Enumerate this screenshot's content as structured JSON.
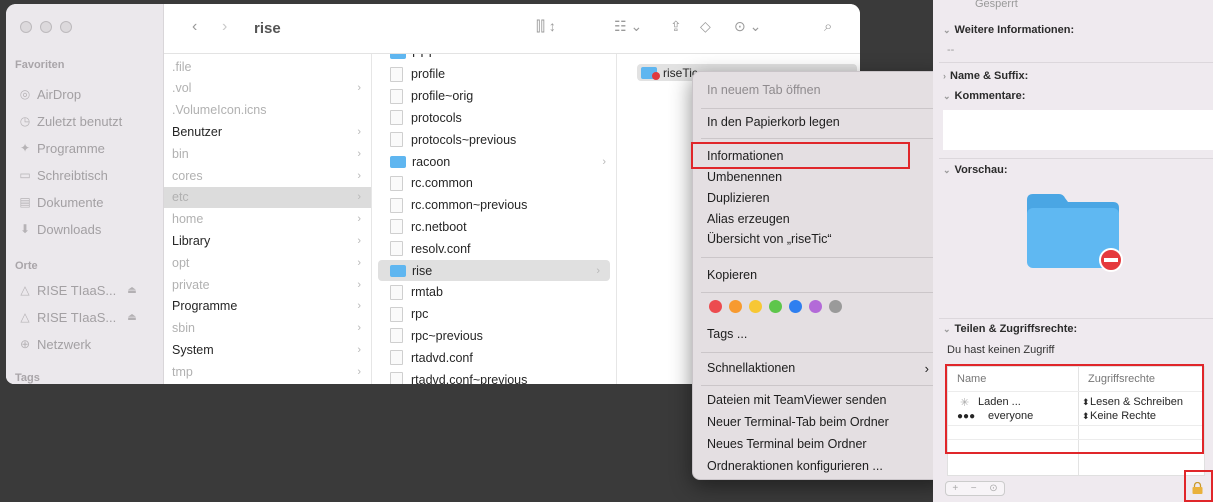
{
  "finder": {
    "title": "rise",
    "sidebar": {
      "favorites_header": "Favoriten",
      "locations_header": "Orte",
      "tags_header": "Tags",
      "favorites": [
        {
          "label": "AirDrop",
          "icon": "airdrop-icon"
        },
        {
          "label": "Zuletzt benutzt",
          "icon": "clock-icon"
        },
        {
          "label": "Programme",
          "icon": "apps-icon"
        },
        {
          "label": "Schreibtisch",
          "icon": "desktop-icon"
        },
        {
          "label": "Dokumente",
          "icon": "document-icon"
        },
        {
          "label": "Downloads",
          "icon": "download-icon"
        }
      ],
      "locations": [
        {
          "label": "RISE TIaaS...",
          "icon": "drive-icon"
        },
        {
          "label": "RISE TIaaS...",
          "icon": "drive-icon"
        },
        {
          "label": "Netzwerk",
          "icon": "network-icon"
        }
      ]
    },
    "column1": [
      {
        "name": ".file",
        "dim": true,
        "chev": false
      },
      {
        "name": ".vol",
        "dim": true,
        "chev": true
      },
      {
        "name": ".VolumeIcon.icns",
        "dim": true,
        "chev": false
      },
      {
        "name": "Benutzer",
        "dim": false,
        "chev": true
      },
      {
        "name": "bin",
        "dim": true,
        "chev": true
      },
      {
        "name": "cores",
        "dim": true,
        "chev": true
      },
      {
        "name": "etc",
        "dim": true,
        "chev": true,
        "selected": true
      },
      {
        "name": "home",
        "dim": true,
        "chev": true
      },
      {
        "name": "Library",
        "dim": false,
        "chev": true
      },
      {
        "name": "opt",
        "dim": true,
        "chev": true
      },
      {
        "name": "private",
        "dim": true,
        "chev": true
      },
      {
        "name": "Programme",
        "dim": false,
        "chev": true
      },
      {
        "name": "sbin",
        "dim": true,
        "chev": true
      },
      {
        "name": "System",
        "dim": false,
        "chev": true
      },
      {
        "name": "tmp",
        "dim": true,
        "chev": true
      }
    ],
    "column2": [
      {
        "name": "PPP",
        "type": "folder"
      },
      {
        "name": "profile",
        "type": "file"
      },
      {
        "name": "profile~orig",
        "type": "file"
      },
      {
        "name": "protocols",
        "type": "file"
      },
      {
        "name": "protocols~previous",
        "type": "file"
      },
      {
        "name": "racoon",
        "type": "folder",
        "chev": true
      },
      {
        "name": "rc.common",
        "type": "file"
      },
      {
        "name": "rc.common~previous",
        "type": "file"
      },
      {
        "name": "rc.netboot",
        "type": "file"
      },
      {
        "name": "resolv.conf",
        "type": "alias"
      },
      {
        "name": "rise",
        "type": "folder",
        "chev": true,
        "selected": true
      },
      {
        "name": "rmtab",
        "type": "file"
      },
      {
        "name": "rpc",
        "type": "file"
      },
      {
        "name": "rpc~previous",
        "type": "file"
      },
      {
        "name": "rtadvd.conf",
        "type": "file"
      },
      {
        "name": "rtadvd.conf~previous",
        "type": "file"
      }
    ],
    "column3_selected": "riseTic"
  },
  "context_menu": {
    "open_new_tab": "In neuem Tab öffnen",
    "trash": "In den Papierkorb legen",
    "info": "Informationen",
    "rename": "Umbenennen",
    "duplicate": "Duplizieren",
    "alias": "Alias erzeugen",
    "overview": "Übersicht von „riseTic“",
    "copy": "Kopieren",
    "tag_colors": [
      "#ec4b4f",
      "#f79a30",
      "#f7c734",
      "#5ec64b",
      "#2e7ff0",
      "#b36ad8",
      "#9a9a9a"
    ],
    "tags": "Tags ...",
    "quick_actions": "Schnellaktionen",
    "teamviewer": "Dateien mit TeamViewer senden",
    "new_terminal_tab": "Neuer Terminal-Tab beim Ordner",
    "new_terminal": "Neues Terminal beim Ordner",
    "folder_actions": "Ordneraktionen konfigurieren ..."
  },
  "info_panel": {
    "locked": "Gesperrt",
    "more_info": "Weitere Informationen:",
    "more_info_value": "--",
    "name_suffix": "Name & Suffix:",
    "comments": "Kommentare:",
    "preview": "Vorschau:",
    "sharing": "Teilen & Zugriffsrechte:",
    "no_access": "Du hast keinen Zugriff",
    "col_name": "Name",
    "col_rights": "Zugriffsrechte",
    "rows": [
      {
        "name": "Laden ...",
        "rights": "Lesen & Schreiben"
      },
      {
        "name": "everyone",
        "rights": "Keine Rechte"
      }
    ]
  }
}
